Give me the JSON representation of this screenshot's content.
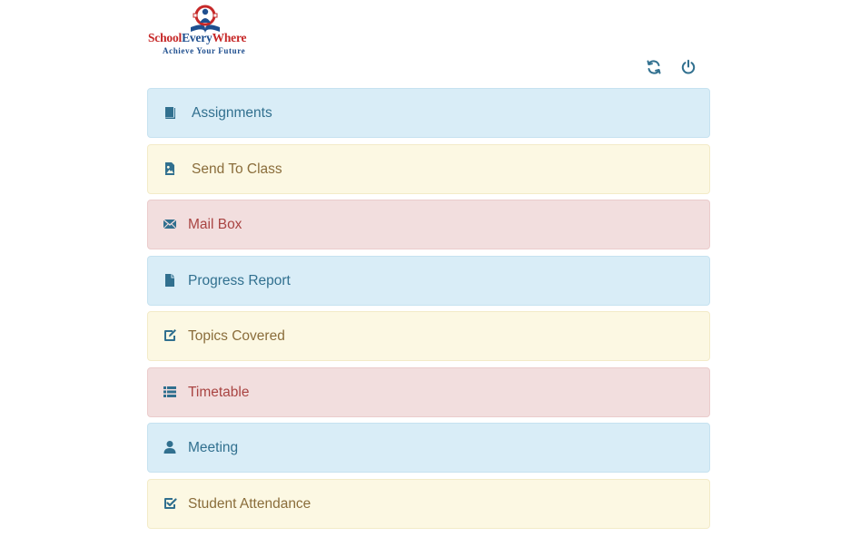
{
  "logo": {
    "word_part1": "School",
    "word_part2": "Every",
    "word_part3": "Where",
    "tagline": "Achieve Your Future",
    "colors": {
      "red": "#c62828",
      "blue": "#1f4f8f"
    }
  },
  "toolbar": {
    "refresh_icon": "refresh-icon",
    "power_icon": "power-icon",
    "icon_color": "#31708f"
  },
  "menu": {
    "items": [
      {
        "label": "Assignments",
        "icon": "book-icon",
        "variant": "info"
      },
      {
        "label": "Send To Class",
        "icon": "image-file-icon",
        "variant": "warning"
      },
      {
        "label": "Mail Box",
        "icon": "envelope-icon",
        "variant": "danger"
      },
      {
        "label": "Progress Report",
        "icon": "document-icon",
        "variant": "info"
      },
      {
        "label": "Topics Covered",
        "icon": "edit-square-icon",
        "variant": "warning"
      },
      {
        "label": "Timetable",
        "icon": "list-icon",
        "variant": "danger"
      },
      {
        "label": "Meeting",
        "icon": "user-icon",
        "variant": "info"
      },
      {
        "label": "Student Attendance",
        "icon": "check-square-icon",
        "variant": "warning"
      }
    ]
  },
  "colors": {
    "info_bg": "#d9edf7",
    "info_text": "#31708f",
    "warning_bg": "#fcf8e3",
    "warning_text": "#8a6d3b",
    "danger_bg": "#f2dede",
    "danger_text": "#a94442"
  }
}
